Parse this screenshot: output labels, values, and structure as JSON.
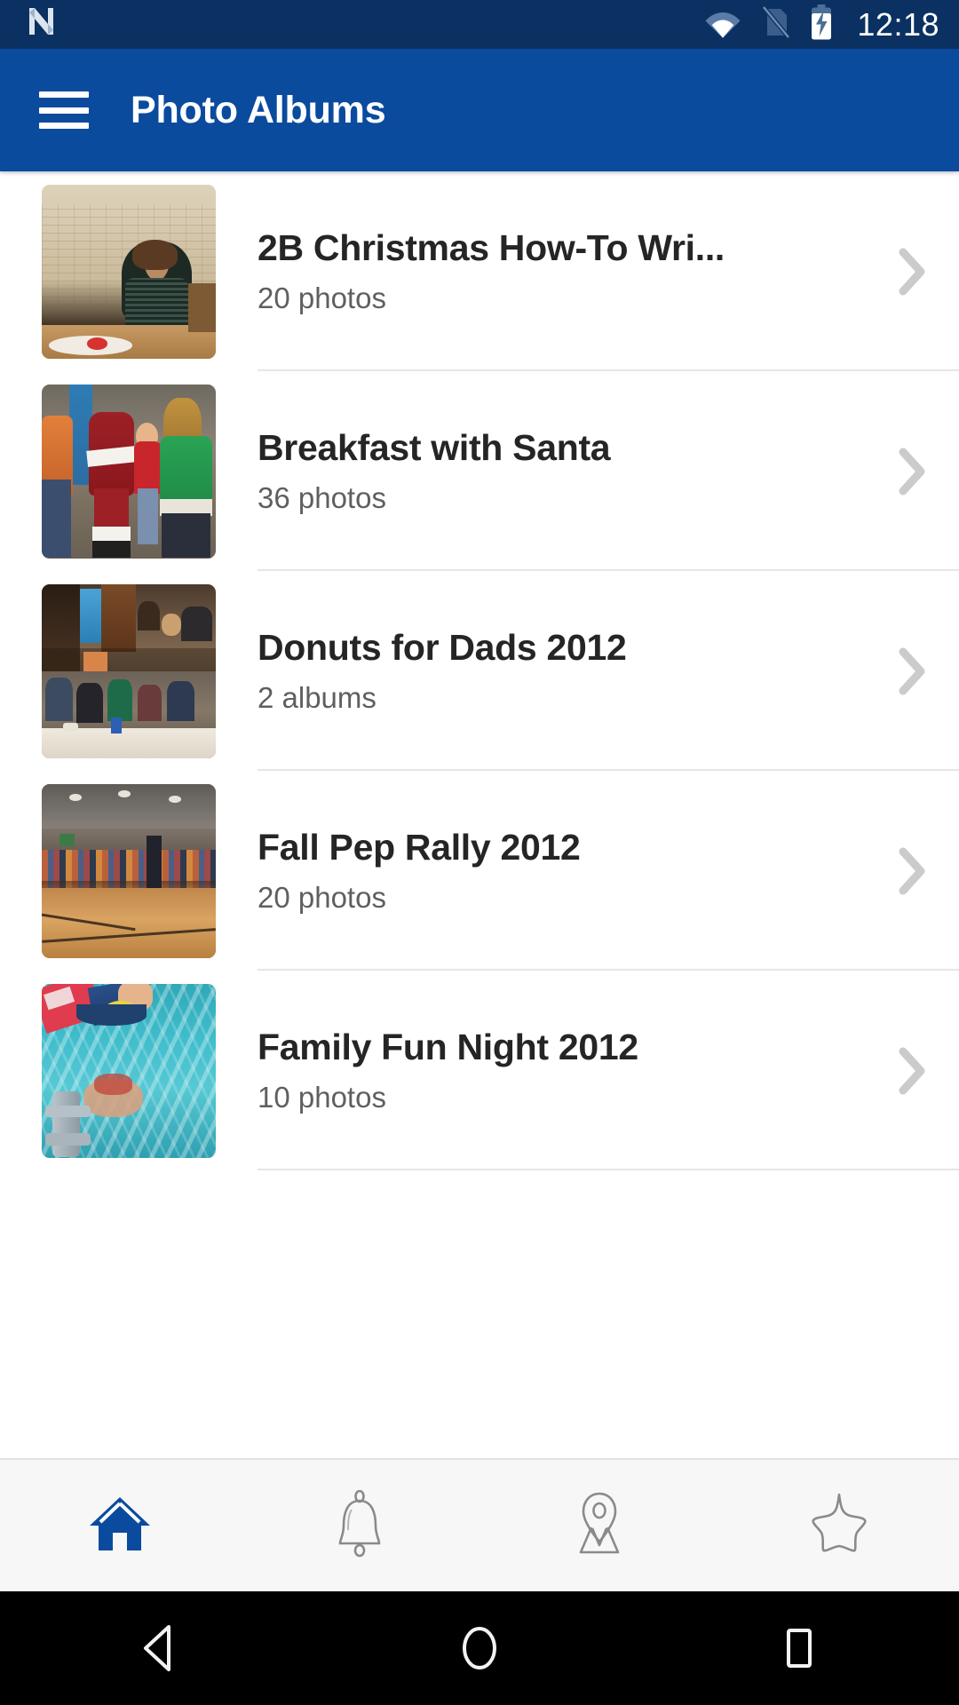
{
  "statusbar": {
    "time": "12:18",
    "icons": [
      "app-notification-icon",
      "wifi-icon",
      "no-sim-icon",
      "battery-charging-icon"
    ]
  },
  "appbar": {
    "menu_icon": "hamburger-menu-icon",
    "title": "Photo Albums",
    "background": "#0b4b9e"
  },
  "list": {
    "items": [
      {
        "title": "2B Christmas How-To Wri...",
        "subtitle": "20 photos",
        "thumb": "boy-at-table-gym",
        "thumb_kind": "single",
        "chevron": "chevron-right-icon"
      },
      {
        "title": "Breakfast with Santa",
        "subtitle": "36 photos",
        "thumb": "santa-with-children",
        "thumb_kind": "single",
        "chevron": "chevron-right-icon"
      },
      {
        "title": "Donuts for Dads 2012",
        "subtitle": "2 albums",
        "thumb": "two-stacked-event-photos",
        "thumb_kind": "split",
        "chevron": "chevron-right-icon"
      },
      {
        "title": "Fall Pep Rally 2012",
        "subtitle": "20 photos",
        "thumb": "gymnasium-assembly",
        "thumb_kind": "single",
        "chevron": "chevron-right-icon"
      },
      {
        "title": "Family Fun Night 2012",
        "subtitle": "10 photos",
        "thumb": "child-swimming-pool",
        "thumb_kind": "single",
        "chevron": "chevron-right-icon"
      }
    ]
  },
  "tabbar": {
    "active_color": "#0b4b9e",
    "inactive_color": "#8a8a8a",
    "tabs": [
      {
        "name": "home",
        "icon": "home-icon",
        "active": true
      },
      {
        "name": "notifications",
        "icon": "bell-icon",
        "active": false
      },
      {
        "name": "map",
        "icon": "map-pin-icon",
        "active": false
      },
      {
        "name": "favorites",
        "icon": "star-icon",
        "active": false
      }
    ]
  },
  "navbar": {
    "buttons": [
      {
        "name": "back",
        "icon": "back-triangle-icon"
      },
      {
        "name": "home",
        "icon": "home-circle-icon"
      },
      {
        "name": "recents",
        "icon": "recents-square-icon"
      }
    ]
  }
}
